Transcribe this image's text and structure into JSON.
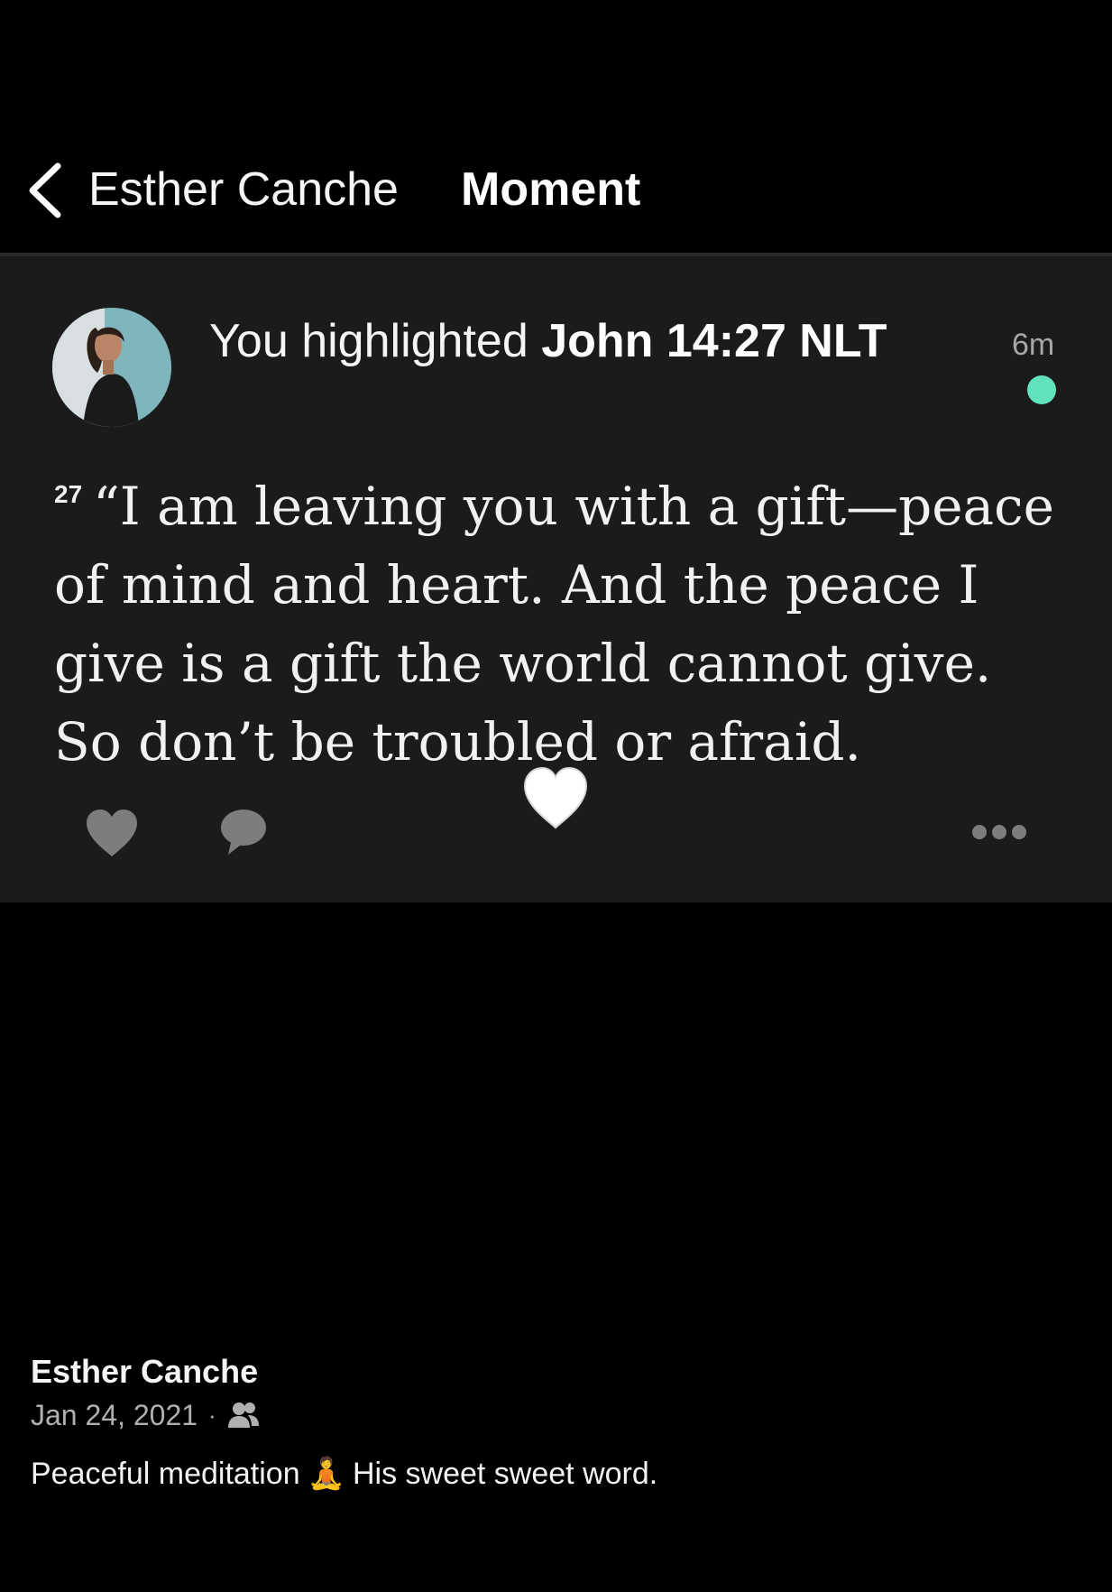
{
  "header": {
    "back_label": "Esther Canche",
    "title": "Moment"
  },
  "card": {
    "highlight_prefix": "You highlighted ",
    "reference": "John 14:27 NLT",
    "time_ago": "6m",
    "verse_number": "27",
    "verse_text": "“I am leaving you with a gift—peace of mind and heart. And the peace I give is a gift the world cannot give. So don’t be troubled or afraid.",
    "reaction_emoji": "heart-icon",
    "status_color": "#61e2bd"
  },
  "actions": {
    "like_icon": "heart-icon",
    "comment_icon": "comment-icon",
    "more_icon": "more-icon"
  },
  "post": {
    "author": "Esther Canche",
    "date": "Jan 24, 2021",
    "separator": "·",
    "audience_icon": "friends-icon",
    "caption_before": "Peaceful meditation",
    "caption_emoji": "🧘",
    "caption_after": "His sweet sweet word."
  }
}
